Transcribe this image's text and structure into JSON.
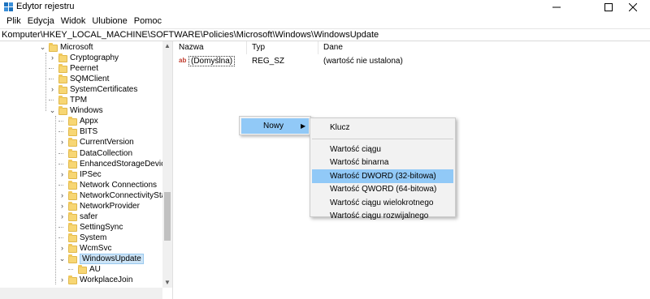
{
  "window": {
    "title": "Edytor rejestru",
    "accent": "#1e73be"
  },
  "menu": [
    "Plik",
    "Edycja",
    "Widok",
    "Ulubione",
    "Pomoc"
  ],
  "address": "Komputer\\HKEY_LOCAL_MACHINE\\SOFTWARE\\Policies\\Microsoft\\Windows\\WindowsUpdate",
  "tree": {
    "items": [
      {
        "label": "Microsoft",
        "level": 0,
        "expander": "down"
      },
      {
        "label": "Cryptography",
        "level": 1,
        "expander": "right"
      },
      {
        "label": "Peernet",
        "level": 1,
        "expander": "none"
      },
      {
        "label": "SQMClient",
        "level": 1,
        "expander": "none"
      },
      {
        "label": "SystemCertificates",
        "level": 1,
        "expander": "right"
      },
      {
        "label": "TPM",
        "level": 1,
        "expander": "none"
      },
      {
        "label": "Windows",
        "level": 1,
        "expander": "down"
      },
      {
        "label": "Appx",
        "level": 2,
        "expander": "none"
      },
      {
        "label": "BITS",
        "level": 2,
        "expander": "none"
      },
      {
        "label": "CurrentVersion",
        "level": 2,
        "expander": "right"
      },
      {
        "label": "DataCollection",
        "level": 2,
        "expander": "none"
      },
      {
        "label": "EnhancedStorageDevices",
        "level": 2,
        "expander": "none"
      },
      {
        "label": "IPSec",
        "level": 2,
        "expander": "right"
      },
      {
        "label": "Network Connections",
        "level": 2,
        "expander": "none"
      },
      {
        "label": "NetworkConnectivityStatu",
        "level": 2,
        "expander": "right"
      },
      {
        "label": "NetworkProvider",
        "level": 2,
        "expander": "right"
      },
      {
        "label": "safer",
        "level": 2,
        "expander": "right"
      },
      {
        "label": "SettingSync",
        "level": 2,
        "expander": "none"
      },
      {
        "label": "System",
        "level": 2,
        "expander": "none"
      },
      {
        "label": "WcmSvc",
        "level": 2,
        "expander": "right"
      },
      {
        "label": "WindowsUpdate",
        "level": 2,
        "expander": "down",
        "selected": true
      },
      {
        "label": "AU",
        "level": 3,
        "expander": "none"
      },
      {
        "label": "WorkplaceJoin",
        "level": 2,
        "expander": "right"
      }
    ]
  },
  "list": {
    "columns": [
      "Nazwa",
      "Typ",
      "Dane"
    ],
    "rows": [
      {
        "name": "(Domyślna)",
        "type": "REG_SZ",
        "data": "(wartość nie ustalona)",
        "icon": "ab"
      }
    ]
  },
  "context_menu": {
    "new_label": "Nowy",
    "submenu": [
      {
        "label": "Klucz"
      },
      {
        "separator": true
      },
      {
        "label": "Wartość ciągu"
      },
      {
        "label": "Wartość binarna"
      },
      {
        "label": "Wartość DWORD (32-bitowa)",
        "highlighted": true
      },
      {
        "label": "Wartość QWORD (64-bitowa)"
      },
      {
        "label": "Wartość ciągu wielokrotnego"
      },
      {
        "label": "Wartość ciągu rozwijalnego"
      }
    ]
  }
}
